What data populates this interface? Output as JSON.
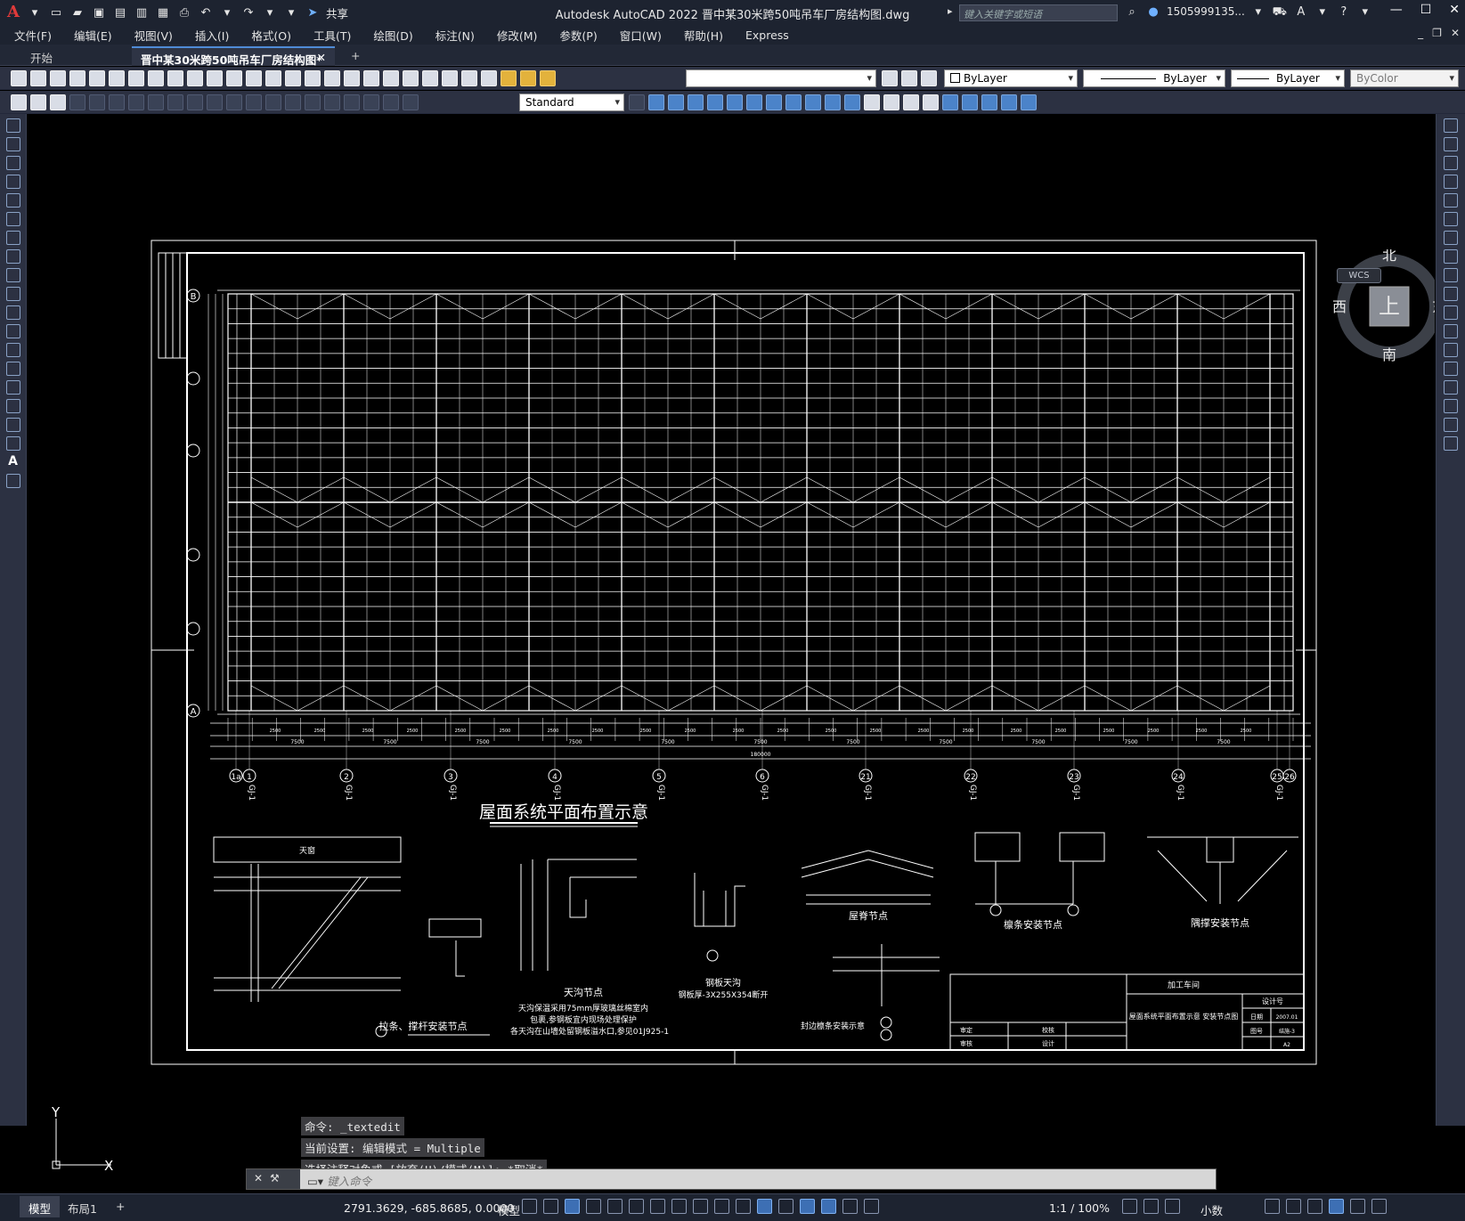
{
  "app": {
    "title": "Autodesk AutoCAD 2022    晋中某30米跨50吨吊车厂房结构图.dwg",
    "share_label": "共享",
    "search_placeholder": "键入关键字或短语",
    "user": "1505999135...",
    "accent": "#4f8bd6"
  },
  "menu": [
    "文件(F)",
    "编辑(E)",
    "视图(V)",
    "插入(I)",
    "格式(O)",
    "工具(T)",
    "绘图(D)",
    "标注(N)",
    "修改(M)",
    "参数(P)",
    "窗口(W)",
    "帮助(H)",
    "Express"
  ],
  "tabs": {
    "start": "开始",
    "doc": "晋中某30米跨50吨吊车厂房结构图*",
    "close": "✕",
    "add": "+"
  },
  "properties": {
    "layer_color": "ByLayer",
    "linetype": "ByLayer",
    "lineweight": "ByLayer",
    "plotstyle": "ByColor",
    "text_style": "Standard"
  },
  "viewcube": {
    "north": "北",
    "south": "南",
    "east": "东",
    "west": "西",
    "top": "上",
    "wcs": "WCS"
  },
  "drawing": {
    "title_plan": "屋面系统平面布置示意",
    "axis_rows": [
      "B",
      "A"
    ],
    "axis_cols": [
      "1a",
      "1",
      "2",
      "3",
      "4",
      "5",
      "6",
      "21",
      "22",
      "23",
      "24",
      "25",
      "26"
    ],
    "frame_label": "GJ-1",
    "detail_labels": {
      "skylight": "天窗",
      "skylight_node": "天沟节点",
      "gutter": "钢板天沟",
      "gutter_spec": "钢板厚-3X255X354断开",
      "ridge_node": "屋脊节点",
      "purlin_node": "檩条安装节点",
      "brace_node": "隅撑安装节点",
      "tie_node": "拉条、撑杆安装节点",
      "end_purlin": "封边檩条安装示意",
      "note1": "天沟保温采用75mm厚玻璃丝棉室内",
      "note2": "包裹,参钢板宜内现场处理保护",
      "note3": "各天沟在山墙处留钢板溢水口,参见01J925-1"
    },
    "titleblock": {
      "workshop": "加工车间",
      "drawing_name": "屋面系统平面布置示意 安装节点图",
      "designer": "设计号",
      "date_label": "日期",
      "date": "2007.01",
      "number_label": "图号",
      "number": "结施-3",
      "sheet": "A2",
      "checked": "审定",
      "proofed": "校核",
      "reviewed": "审核",
      "designed": "设计"
    },
    "dims": {
      "total": "180000",
      "bay": "7500",
      "sub": "2500"
    }
  },
  "command": {
    "lines": [
      "命令: _textedit",
      "当前设置: 编辑模式 = Multiple",
      "选择注释对象或 [放弃(U)/模式(M)]: *取消*"
    ],
    "placeholder": "键入命令"
  },
  "ucs": {
    "x": "X",
    "y": "Y"
  },
  "status": {
    "tab_model": "模型",
    "tab_layout": "布局1",
    "add": "+",
    "coords": "2791.3629, -685.8685, 0.0000",
    "space": "模型",
    "scale": "1:1 / 100%",
    "units": "小数"
  }
}
